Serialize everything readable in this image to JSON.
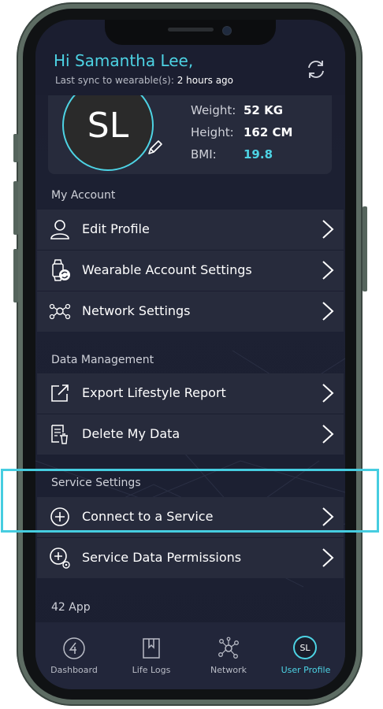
{
  "header": {
    "greeting": "Hi Samantha Lee,",
    "sync_prefix": "Last sync to wearable(s):",
    "sync_time": "2 hours ago"
  },
  "profile": {
    "initials": "SL",
    "weight_label": "Weight:",
    "weight_value": "52 KG",
    "height_label": "Height:",
    "height_value": "162 CM",
    "bmi_label": "BMI:",
    "bmi_value": "19.8"
  },
  "my_account": {
    "title": "My Account",
    "items": [
      {
        "label": "Edit Profile",
        "icon": "user-icon"
      },
      {
        "label": "Wearable Account Settings",
        "icon": "watch-sync-icon"
      },
      {
        "label": "Network Settings",
        "icon": "network-icon"
      }
    ]
  },
  "data_management": {
    "title": "Data Management",
    "items": [
      {
        "label": "Export Lifestyle Report",
        "icon": "export-icon"
      },
      {
        "label": "Delete My Data",
        "icon": "delete-data-icon"
      }
    ]
  },
  "service_settings": {
    "title": "Service Settings",
    "items": [
      {
        "label": "Connect to a Service",
        "icon": "plus-circle-icon"
      },
      {
        "label": "Service Data Permissions",
        "icon": "plus-circle-gear-icon"
      }
    ]
  },
  "app_section": {
    "title": "42 App"
  },
  "tabbar": {
    "items": [
      {
        "label": "Dashboard",
        "icon": "dashboard-icon"
      },
      {
        "label": "Life Logs",
        "icon": "bookmark-icon"
      },
      {
        "label": "Network",
        "icon": "network-icon"
      },
      {
        "label": "User Profile",
        "badge": "SL",
        "active": true
      }
    ]
  },
  "colors": {
    "accent": "#4dd3e4",
    "background": "#1b1e30",
    "row": "#272b3c"
  }
}
